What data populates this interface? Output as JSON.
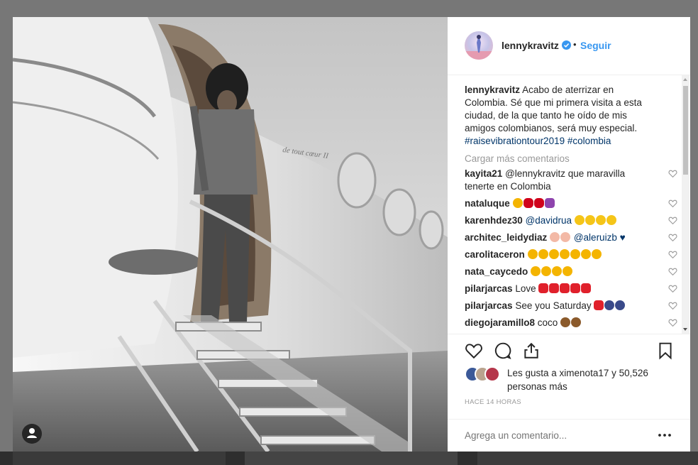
{
  "post": {
    "username": "lennykravitz",
    "follow_label": "Seguir",
    "dot": "•",
    "caption_user": "lennykravitz",
    "caption_text": "Acabo de aterrizar en Colombia. Sé que mi primera visita a esta ciudad, de la que tanto he oído de mis amigos colombianos, será muy especial.",
    "hashtag1": "#raisevibrationtour2019",
    "hashtag2": "#colombia",
    "load_more": "Cargar más comentarios",
    "photo_text": "de tout cœur II",
    "likes_text": "Les gusta a ximenota17 y 50,526 personas más",
    "time": "HACE 14 HORAS",
    "add_comment_placeholder": "Agrega un comentario...",
    "more_dots": "•••"
  },
  "comments": [
    {
      "user": "kayita21",
      "text": "@lennykravitz que maravilla tenerte en Colombia"
    },
    {
      "user": "nataluque",
      "text": ""
    },
    {
      "user": "karenhdez30",
      "text": "@davidrua"
    },
    {
      "user": "architec_leidydiaz",
      "text": "@aleruizb ♥"
    },
    {
      "user": "carolitaceron",
      "text": ""
    },
    {
      "user": "nata_caycedo",
      "text": ""
    },
    {
      "user": "pilarjarcas",
      "text": "Love"
    },
    {
      "user": "pilarjarcas",
      "text": "See you Saturday"
    },
    {
      "user": "diegojaramillo8",
      "text": "coco"
    }
  ],
  "colors": {
    "accent": "#3897f0",
    "text": "#262626",
    "muted": "#999999",
    "hashtag": "#003569"
  },
  "icons": [
    "verified-icon",
    "heart-icon",
    "comment-icon",
    "share-icon",
    "bookmark-icon",
    "user-icon",
    "more-icon"
  ]
}
